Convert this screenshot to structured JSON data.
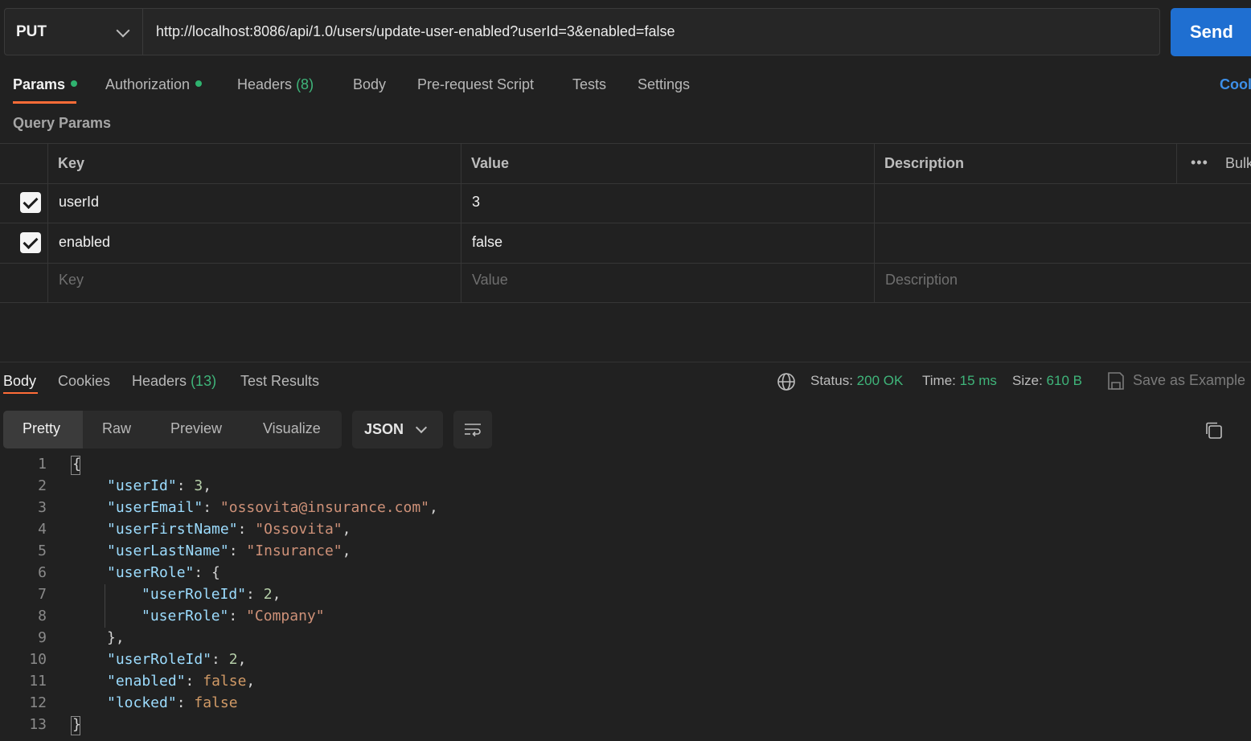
{
  "request": {
    "method": "PUT",
    "url": "http://localhost:8086/api/1.0/users/update-user-enabled?userId=3&enabled=false",
    "send_label": "Send"
  },
  "request_tabs": [
    {
      "label": "Params",
      "active": true,
      "dot": true
    },
    {
      "label": "Authorization",
      "dot": true
    },
    {
      "label": "Headers",
      "count": "(8)"
    },
    {
      "label": "Body"
    },
    {
      "label": "Pre-request Script"
    },
    {
      "label": "Tests"
    },
    {
      "label": "Settings"
    }
  ],
  "cookies_link": "Cool",
  "query_params": {
    "title": "Query Params",
    "headers": {
      "key": "Key",
      "value": "Value",
      "description": "Description",
      "more": "•••",
      "bulk": "Bulk"
    },
    "rows": [
      {
        "checked": true,
        "key": "userId",
        "value": "3"
      },
      {
        "checked": true,
        "key": "enabled",
        "value": "false"
      }
    ],
    "placeholders": {
      "key": "Key",
      "value": "Value",
      "description": "Description"
    }
  },
  "response": {
    "tabs": [
      {
        "label": "Body",
        "active": true
      },
      {
        "label": "Cookies"
      },
      {
        "label": "Headers",
        "count": "(13)"
      },
      {
        "label": "Test Results"
      }
    ],
    "status_label": "Status:",
    "status_value": "200 OK",
    "time_label": "Time:",
    "time_value": "15 ms",
    "size_label": "Size:",
    "size_value": "610 B",
    "save_example": "Save as Example",
    "formats": [
      "Pretty",
      "Raw",
      "Preview",
      "Visualize"
    ],
    "language": "JSON",
    "code_lines": [
      {
        "n": "1",
        "tokens": [
          {
            "t": "p",
            "v": "{"
          }
        ]
      },
      {
        "n": "2",
        "tokens": [
          {
            "t": "k",
            "v": "\"userId\""
          },
          {
            "t": "p",
            "v": ": "
          },
          {
            "t": "n",
            "v": "3"
          },
          {
            "t": "p",
            "v": ","
          }
        ]
      },
      {
        "n": "3",
        "tokens": [
          {
            "t": "k",
            "v": "\"userEmail\""
          },
          {
            "t": "p",
            "v": ": "
          },
          {
            "t": "s",
            "v": "\"ossovita@insurance.com\""
          },
          {
            "t": "p",
            "v": ","
          }
        ]
      },
      {
        "n": "4",
        "tokens": [
          {
            "t": "k",
            "v": "\"userFirstName\""
          },
          {
            "t": "p",
            "v": ": "
          },
          {
            "t": "s",
            "v": "\"Ossovita\""
          },
          {
            "t": "p",
            "v": ","
          }
        ]
      },
      {
        "n": "5",
        "tokens": [
          {
            "t": "k",
            "v": "\"userLastName\""
          },
          {
            "t": "p",
            "v": ": "
          },
          {
            "t": "s",
            "v": "\"Insurance\""
          },
          {
            "t": "p",
            "v": ","
          }
        ]
      },
      {
        "n": "6",
        "tokens": [
          {
            "t": "k",
            "v": "\"userRole\""
          },
          {
            "t": "p",
            "v": ": {"
          }
        ]
      },
      {
        "n": "7",
        "tokens": [
          {
            "t": "k",
            "v": "\"userRoleId\""
          },
          {
            "t": "p",
            "v": ": "
          },
          {
            "t": "n",
            "v": "2"
          },
          {
            "t": "p",
            "v": ","
          }
        ]
      },
      {
        "n": "8",
        "tokens": [
          {
            "t": "k",
            "v": "\"userRole\""
          },
          {
            "t": "p",
            "v": ": "
          },
          {
            "t": "s",
            "v": "\"Company\""
          }
        ]
      },
      {
        "n": "9",
        "tokens": [
          {
            "t": "p",
            "v": "},"
          }
        ]
      },
      {
        "n": "10",
        "tokens": [
          {
            "t": "k",
            "v": "\"userRoleId\""
          },
          {
            "t": "p",
            "v": ": "
          },
          {
            "t": "n",
            "v": "2"
          },
          {
            "t": "p",
            "v": ","
          }
        ]
      },
      {
        "n": "11",
        "tokens": [
          {
            "t": "k",
            "v": "\"enabled\""
          },
          {
            "t": "p",
            "v": ": "
          },
          {
            "t": "b",
            "v": "false"
          },
          {
            "t": "p",
            "v": ","
          }
        ]
      },
      {
        "n": "12",
        "tokens": [
          {
            "t": "k",
            "v": "\"locked\""
          },
          {
            "t": "p",
            "v": ": "
          },
          {
            "t": "b",
            "v": "false"
          }
        ]
      },
      {
        "n": "13",
        "tokens": [
          {
            "t": "p",
            "v": "}"
          }
        ]
      }
    ]
  },
  "icons": {
    "method_dropdown": "chevron-down-icon",
    "status": "globe-icon",
    "save": "save-icon",
    "wrap": "wrap-lines-icon",
    "copy": "copy-icon"
  },
  "colors": {
    "accent": "#ff6c37",
    "send": "#1f6fd1",
    "success": "#3fb57a"
  }
}
